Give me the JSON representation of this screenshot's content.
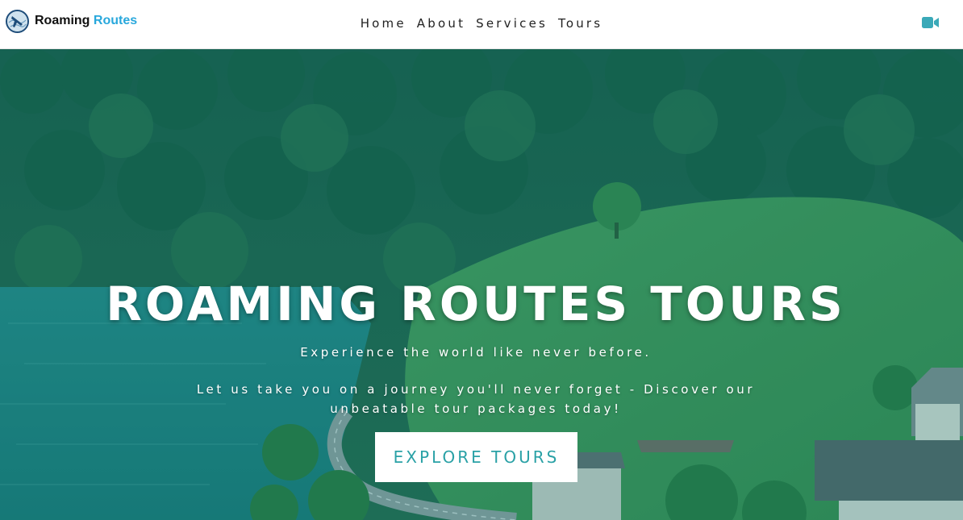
{
  "header": {
    "brand": {
      "name_part1": "Roaming",
      "name_part2": "Routes",
      "logo_icon": "globe-plane-icon"
    },
    "nav": [
      {
        "label": "Home"
      },
      {
        "label": "About"
      },
      {
        "label": "Services"
      },
      {
        "label": "Tours"
      }
    ],
    "video_icon": "video-camera-icon"
  },
  "hero": {
    "title": "ROAMING ROUTES TOURS",
    "tagline": "Experience the world like never before.",
    "description": "Let us take you on a journey you'll never forget - Discover our unbeatable tour packages today!",
    "cta_label": "EXPLORE TOURS"
  },
  "colors": {
    "accent": "#29a8dc",
    "cta_text": "#2aa1a6",
    "video_icon": "#3aa9b8",
    "overlay": "#007676"
  }
}
